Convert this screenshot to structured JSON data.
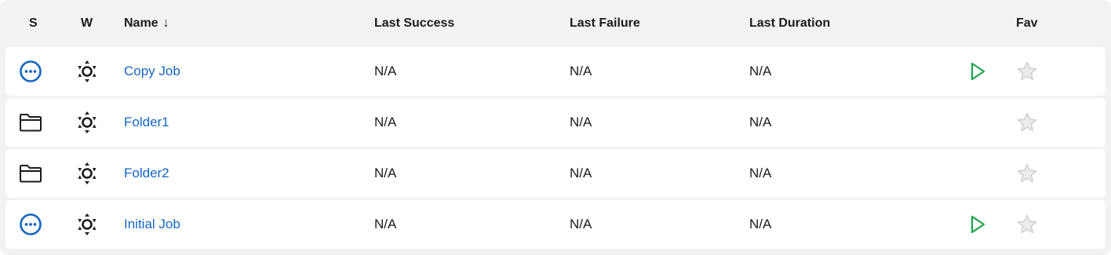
{
  "columns": {
    "status": "S",
    "weather": "W",
    "name": "Name",
    "name_sort_indicator": "↓",
    "last_success": "Last Success",
    "last_failure": "Last Failure",
    "last_duration": "Last Duration",
    "fav": "Fav"
  },
  "rows": [
    {
      "status_icon": "not-built-icon",
      "weather_icon": "weather-icon",
      "name": "Copy Job",
      "last_success": "N/A",
      "last_failure": "N/A",
      "last_duration": "N/A",
      "has_build_button": true,
      "favorite": false
    },
    {
      "status_icon": "folder-icon",
      "weather_icon": "weather-icon",
      "name": "Folder1",
      "last_success": "N/A",
      "last_failure": "N/A",
      "last_duration": "N/A",
      "has_build_button": false,
      "favorite": false
    },
    {
      "status_icon": "folder-icon",
      "weather_icon": "weather-icon",
      "name": "Folder2",
      "last_success": "N/A",
      "last_failure": "N/A",
      "last_duration": "N/A",
      "has_build_button": false,
      "favorite": false
    },
    {
      "status_icon": "not-built-icon",
      "weather_icon": "weather-icon",
      "name": "Initial Job",
      "last_success": "N/A",
      "last_failure": "N/A",
      "last_duration": "N/A",
      "has_build_button": true,
      "favorite": false
    }
  ],
  "colors": {
    "link": "#1466c2",
    "status_not_built": "#1466c2",
    "build_button": "#1ea64b",
    "star": "#d0d0d0",
    "header_bg": "#f2f2f5"
  }
}
